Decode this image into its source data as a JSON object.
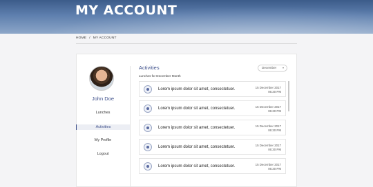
{
  "hero": {
    "title": "MY ACCOUNT"
  },
  "breadcrumb": {
    "home": "HOME",
    "sep": "/",
    "current": "MY ACCOUNT"
  },
  "profile": {
    "name": "John Doe"
  },
  "nav": {
    "items": [
      {
        "label": "Lunches",
        "active": false
      },
      {
        "label": "Activities",
        "active": true
      },
      {
        "label": "My Profile",
        "active": false
      },
      {
        "label": "Logout",
        "active": false
      }
    ]
  },
  "activities": {
    "title": "Activities",
    "subtitle": "Lunches for December Month",
    "month_select": "December",
    "rows": [
      {
        "text": "Lorem ipsum dolor sit amet, consectetuer.",
        "date": "15 December 2017",
        "time": "06:30 PM"
      },
      {
        "text": "Lorem ipsum dolor sit amet, consectetuer.",
        "date": "15 December 2017",
        "time": "06:30 PM"
      },
      {
        "text": "Lorem ipsum dolor sit amet, consectetuer.",
        "date": "15 December 2017",
        "time": "06:30 PM"
      },
      {
        "text": "Lorem ipsum dolor sit amet, consectetuer.",
        "date": "15 December 2017",
        "time": "06:30 PM"
      },
      {
        "text": "Lorem ipsum dolor sit amet, consectetuer.",
        "date": "15 December 2017",
        "time": "06:30 PM"
      }
    ]
  },
  "colors": {
    "accent": "#3d4f8a",
    "hero": "#4a6a98"
  }
}
